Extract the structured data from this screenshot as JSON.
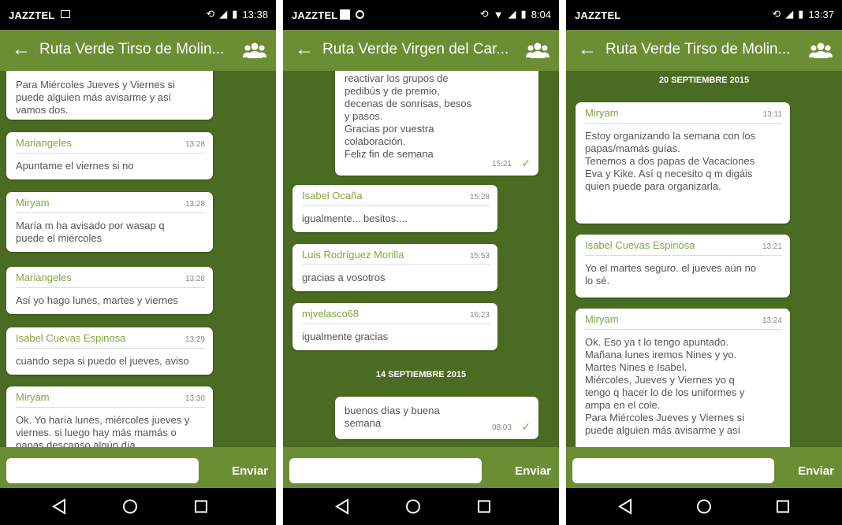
{
  "colors": {
    "appbar": "#6b8e34",
    "chat_bg": "#4a6b22",
    "accent": "#7ea83e",
    "statusbar": "#000000"
  },
  "send_label": "Enviar",
  "phones": [
    {
      "status": {
        "carrier": "JAZZTEL",
        "time": "13:38"
      },
      "title": "Ruta Verde Tirso de Molin...",
      "messages": [
        {
          "text": "Para Miércoles Jueves y Viernes si\npuede alguien más avisarme y así\nvamos dos."
        },
        {
          "sender": "Mariangeles",
          "time": "13:28",
          "text": "Apuntame el viernes si no"
        },
        {
          "sender": "Miryam",
          "time": "13:28",
          "text": "María m ha avisado por wasap q\npuede el miércoles"
        },
        {
          "sender": "Mariangeles",
          "time": "13:28",
          "text": "Así yo hago lunes, martes y viernes"
        },
        {
          "sender": "Isabel Cuevas Espinosa",
          "time": "13:29",
          "text": "cuando sepa si puedo el jueves, aviso"
        },
        {
          "sender": "Miryam",
          "time": "13:30",
          "text": "Ok.  Yo haría lunes, miércoles jueves y\nviernes. si luego hay más mamás o\npapas descanso algún día."
        }
      ]
    },
    {
      "status": {
        "carrier": "JAZZTEL",
        "time": "8:04"
      },
      "title": "Ruta Verde Virgen del Car...",
      "messages": [
        {
          "text": "reactivar los grupos de\npedibús y de premio,\ndecenas de sonrisas, besos\ny pasos.\nGracias por vuestra\ncolaboración.\nFeliz fin de semana",
          "time": "15:21"
        },
        {
          "sender": "Isabel Ocaña",
          "time": "15:28",
          "text": "igualmente... besitos...."
        },
        {
          "sender": "Luis Rodríguez Morilla",
          "time": "15:53",
          "text": "gracias a vosotros"
        },
        {
          "sender": "mjvelasco68",
          "time": "16:23",
          "text": "igualmente  gracias"
        },
        {
          "date": "14 SEPTIEMBRE 2015"
        },
        {
          "text": "buenos días y buena\nsemana",
          "time": "08:03"
        }
      ]
    },
    {
      "status": {
        "carrier": "JAZZTEL",
        "time": "13:37"
      },
      "title": "Ruta Verde Tirso de Molin...",
      "messages": [
        {
          "date": "20 SEPTIEMBRE 2015"
        },
        {
          "sender": "Miryam",
          "time": "13:11",
          "text": "Estoy organizando la semana con los\npapas/mamás guías.\nTenemos a dos papas de Vacaciones\nEva y Kike. Así q necesito q m digáis\nquien puede para organizarla."
        },
        {
          "sender": "Isabel Cuevas Espinosa",
          "time": "13:21",
          "text": "Yo el martes seguro. el jueves aún no\nlo sé."
        },
        {
          "sender": "Miryam",
          "time": "13:24",
          "text": "Ok. Eso ya t lo tengo apuntado.\nMañana lunes iremos Nines y yo.\nMartes Nines e Isabel.\nMiércoles,  Jueves y Viernes yo q\ntengo q hacer lo de los uniformes y\nampa en el cole.\nPara Miércoles Jueves y Viernes si\npuede alguien más avisarme y así"
        }
      ]
    }
  ]
}
